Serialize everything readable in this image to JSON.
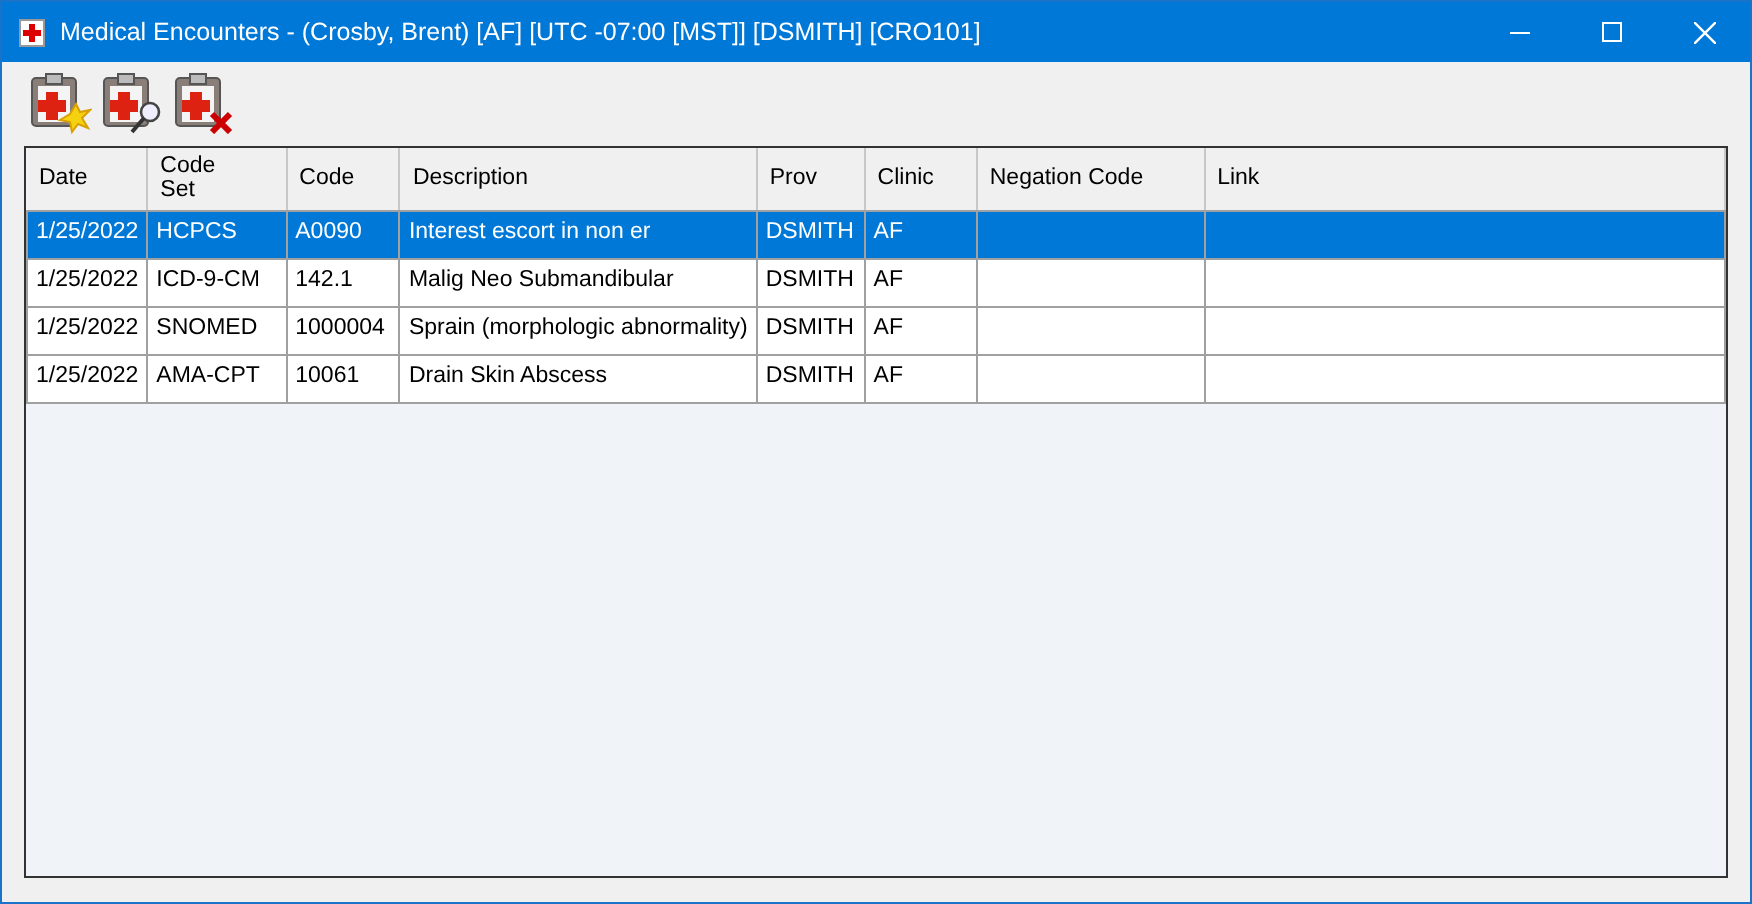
{
  "window": {
    "title": "Medical Encounters - (Crosby, Brent) [AF] [UTC -07:00 [MST]] [DSMITH] [CRO101]"
  },
  "table": {
    "columns": [
      "Date",
      "Code\nSet",
      "Code",
      "Description",
      "Prov",
      "Clinic",
      "Negation Code",
      "Link"
    ],
    "rows": [
      {
        "selected": true,
        "cells": [
          "1/25/2022",
          "HCPCS",
          "A0090",
          "Interest escort in non er",
          "DSMITH",
          "AF"
        ]
      },
      {
        "selected": false,
        "cells": [
          "1/25/2022",
          "ICD-9-CM",
          "142.1",
          "Malig Neo Submandibular",
          "DSMITH",
          "AF"
        ]
      },
      {
        "selected": false,
        "cells": [
          "1/25/2022",
          "SNOMED",
          "1000004",
          "Sprain (morphologic abnormality)",
          "DSMITH",
          "AF"
        ]
      },
      {
        "selected": false,
        "cells": [
          "1/25/2022",
          "AMA-CPT",
          "10061",
          "Drain Skin Abscess",
          "DSMITH",
          "AF"
        ]
      }
    ]
  }
}
